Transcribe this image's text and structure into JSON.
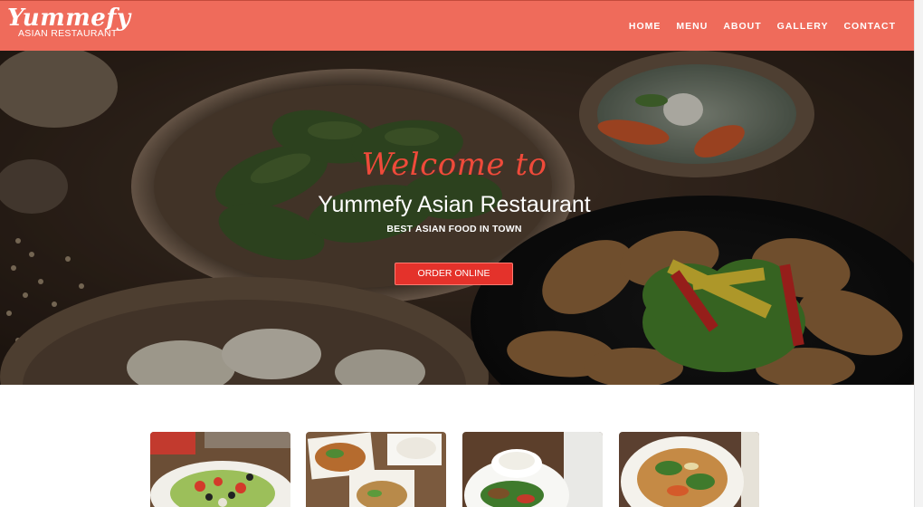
{
  "header": {
    "logo_script": "Yummefy",
    "logo_sub": "ASIAN RESTAURANT",
    "nav": [
      "HOME",
      "MENU",
      "ABOUT",
      "GALLERY",
      "CONTACT"
    ],
    "background": "#ef6b5b"
  },
  "hero": {
    "welcome": "Welcome to",
    "title": "Yummefy Asian Restaurant",
    "subtitle": "BEST ASIAN FOOD IN TOWN",
    "button_label": "ORDER ONLINE",
    "accent": "#e4322b"
  },
  "gallery": {
    "thumbs": [
      "salad-photo",
      "noodle-platter-photo",
      "rice-stirfry-photo",
      "pad-thai-photo"
    ]
  }
}
